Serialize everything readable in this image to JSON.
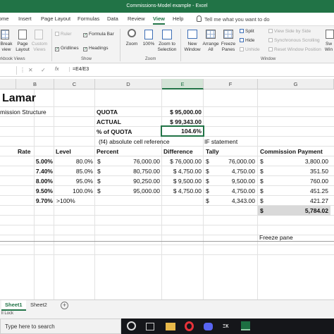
{
  "window": {
    "title": "Commissions-Model example  -  Excel"
  },
  "tabs": [
    "ome",
    "Insert",
    "Page Layout",
    "Formulas",
    "Data",
    "Review",
    "View",
    "Help"
  ],
  "tell_me": "Tell me what you want to do",
  "ribbon": {
    "workbook_views": {
      "break_line1": "Break",
      "break_line2": "view",
      "page_line1": "Page",
      "page_line2": "Layout",
      "custom_line1": "Custom",
      "custom_line2": "Views",
      "group": "rkbook Views"
    },
    "show": {
      "ruler": "Ruler",
      "gridlines": "Gridlines",
      "formula_bar": "Formula Bar",
      "headings": "Headings",
      "group": "Show"
    },
    "zoom": {
      "zoom": "Zoom",
      "hundred": "100%",
      "sel_line1": "Zoom to",
      "sel_line2": "Selection",
      "group": "Zoom"
    },
    "window": {
      "new_line1": "New",
      "new_line2": "Window",
      "arrange_line1": "Arrange",
      "arrange_line2": "All",
      "freeze_line1": "Freeze",
      "freeze_line2": "Panes",
      "split": "Split",
      "hide": "Hide",
      "unhide": "Unhide",
      "side_by_side": "View Side by Side",
      "sync": "Synchronous Scrolling",
      "reset": "Reset Window Position",
      "switch_line1": "Sw",
      "switch_line2": "Win",
      "group": "Window"
    }
  },
  "formula_bar": {
    "fx": "fx",
    "formula": "=E4/E3"
  },
  "columns": [
    "B",
    "C",
    "D",
    "E",
    "F",
    "G"
  ],
  "cells": {
    "title": "Lamar",
    "structure": "mission Structure",
    "quota_label": "QUOTA",
    "quota_value": "$ 95,000.00",
    "actual_label": "ACTUAL",
    "actual_value": "$ 99,343.00",
    "pct_label": "% of QUOTA",
    "pct_value": "104.6%",
    "note_abs": "(f4) absolute cell reference",
    "note_if": "IF statement",
    "freeze_note": "Freeze pane"
  },
  "table": {
    "headers": {
      "rate": "Rate",
      "level": "Level",
      "percent": "Percent",
      "difference": "Difference",
      "tally": "Tally",
      "commission": "Commission Payment"
    },
    "rows": [
      {
        "rate": "5.00%",
        "level": "80.0%",
        "percent": "76,000.00",
        "difference": "$ 76,000.00",
        "tally": "76,000.00",
        "payment": "3,800.00"
      },
      {
        "rate": "7.40%",
        "level": "85.0%",
        "percent": "80,750.00",
        "difference": "$ 4,750.00",
        "tally": "4,750.00",
        "payment": "351.50"
      },
      {
        "rate": "8.00%",
        "level": "95.0%",
        "percent": "90,250.00",
        "difference": "$ 9,500.00",
        "tally": "9,500.00",
        "payment": "760.00"
      },
      {
        "rate": "9.50%",
        "level": "100.0%",
        "percent": "95,000.00",
        "difference": "$ 4,750.00",
        "tally": "4,750.00",
        "payment": "451.25"
      },
      {
        "rate": "9.70%",
        "level": ">100%",
        "percent": "",
        "difference": "",
        "tally": "4,343.00",
        "payment": "421.27"
      }
    ],
    "total": "5,784.02",
    "currency": "$"
  },
  "sheets": [
    "Sheet1",
    "Sheet2"
  ],
  "status": "ll Lock",
  "taskbar": {
    "search_placeholder": "Type here to search"
  },
  "colors": {
    "excel_green": "#217346",
    "total_fill": "#d9d9d9"
  }
}
